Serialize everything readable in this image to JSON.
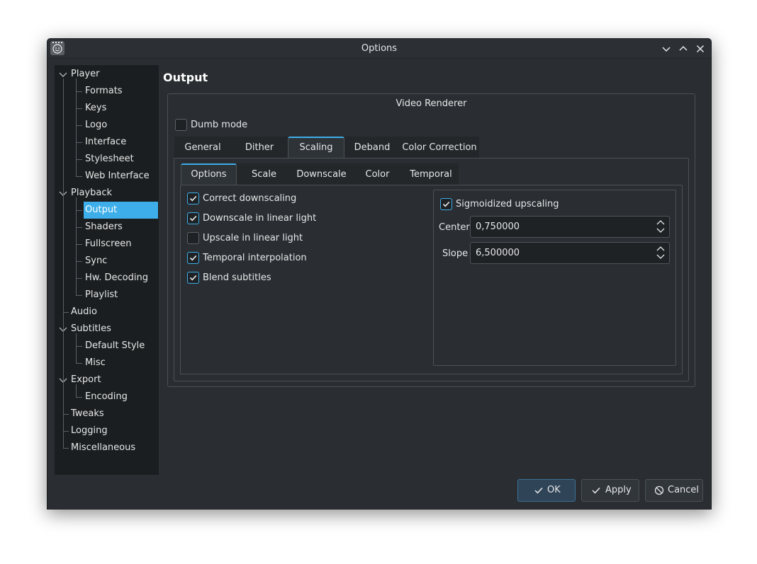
{
  "window": {
    "title": "Options"
  },
  "titlebar_icons": {
    "app": "smiley-app-icon",
    "minimize": "chevron-down-icon",
    "maximize": "chevron-up-icon",
    "close": "close-icon"
  },
  "sidebar": {
    "items": [
      {
        "label": "Player",
        "level": 0,
        "expanded": true
      },
      {
        "label": "Formats",
        "level": 1
      },
      {
        "label": "Keys",
        "level": 1
      },
      {
        "label": "Logo",
        "level": 1
      },
      {
        "label": "Interface",
        "level": 1
      },
      {
        "label": "Stylesheet",
        "level": 1
      },
      {
        "label": "Web Interface",
        "level": 1
      },
      {
        "label": "Playback",
        "level": 0,
        "expanded": true
      },
      {
        "label": "Output",
        "level": 1,
        "selected": true
      },
      {
        "label": "Shaders",
        "level": 1
      },
      {
        "label": "Fullscreen",
        "level": 1
      },
      {
        "label": "Sync",
        "level": 1
      },
      {
        "label": "Hw. Decoding",
        "level": 1
      },
      {
        "label": "Playlist",
        "level": 1
      },
      {
        "label": "Audio",
        "level": 0
      },
      {
        "label": "Subtitles",
        "level": 0,
        "expanded": true
      },
      {
        "label": "Default Style",
        "level": 1
      },
      {
        "label": "Misc",
        "level": 1
      },
      {
        "label": "Export",
        "level": 0,
        "expanded": true
      },
      {
        "label": "Encoding",
        "level": 1
      },
      {
        "label": "Tweaks",
        "level": 0
      },
      {
        "label": "Logging",
        "level": 0
      },
      {
        "label": "Miscellaneous",
        "level": 0
      }
    ]
  },
  "main": {
    "title": "Output",
    "group_title": "Video Renderer",
    "dumb_mode": {
      "label": "Dumb mode",
      "checked": false
    },
    "tabs": [
      {
        "label": "General"
      },
      {
        "label": "Dither"
      },
      {
        "label": "Scaling",
        "active": true
      },
      {
        "label": "Deband"
      },
      {
        "label": "Color Correction"
      }
    ],
    "subtabs": [
      {
        "label": "Options",
        "active": true
      },
      {
        "label": "Scale"
      },
      {
        "label": "Downscale"
      },
      {
        "label": "Color"
      },
      {
        "label": "Temporal"
      }
    ],
    "options": [
      {
        "label": "Correct downscaling",
        "checked": true
      },
      {
        "label": "Downscale in linear light",
        "checked": true
      },
      {
        "label": "Upscale in linear light",
        "checked": false
      },
      {
        "label": "Temporal interpolation",
        "checked": true
      },
      {
        "label": "Blend subtitles",
        "checked": true
      }
    ],
    "sigmoid": {
      "label": "Sigmoidized upscaling",
      "checked": true,
      "center_label": "Center",
      "center_value": "0,750000",
      "slope_label": "Slope",
      "slope_value": "6,500000"
    }
  },
  "buttons": {
    "ok": "OK",
    "apply": "Apply",
    "cancel": "Cancel"
  },
  "colors": {
    "accent": "#3daee9",
    "window_bg": "#2a2e32",
    "sidebar_bg": "#1b1e20"
  }
}
